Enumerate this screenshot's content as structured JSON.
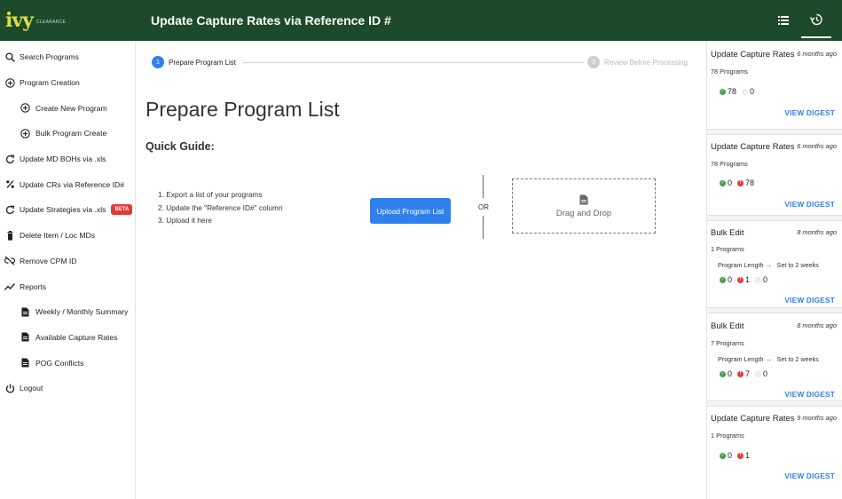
{
  "app": {
    "logo_text": "ivy",
    "logo_sub": "CLEARANCE",
    "title": "Update Capture Rates via Reference ID #"
  },
  "sidebar": {
    "items": [
      {
        "label": "Search Programs",
        "icon": "search-icon"
      },
      {
        "label": "Program Creation",
        "icon": "plus-circle-icon"
      },
      {
        "label": "Create New Program",
        "icon": "plus-circle-icon"
      },
      {
        "label": "Bulk Program Create",
        "icon": "plus-circle-icon"
      },
      {
        "label": "Update MD BOHs via .xls",
        "icon": "refresh-icon"
      },
      {
        "label": "Update CRs via Reference ID#",
        "icon": "percent-icon"
      },
      {
        "label": "Update Strategies via .xls",
        "icon": "refresh-icon",
        "badge": "BETA"
      },
      {
        "label": "Delete Item / Loc MDs",
        "icon": "trash-icon"
      },
      {
        "label": "Remove CPM ID",
        "icon": "link-off-icon"
      },
      {
        "label": "Reports",
        "icon": "trend-icon"
      },
      {
        "label": "Weekly / Monthly Summary",
        "icon": "document-icon"
      },
      {
        "label": "Available Capture Rates",
        "icon": "document-icon"
      },
      {
        "label": "POG Conflicts",
        "icon": "document-icon"
      },
      {
        "label": "Logout",
        "icon": "power-icon"
      }
    ]
  },
  "stepper": {
    "steps": [
      {
        "num": "1",
        "label": "Prepare Program List",
        "active": true
      },
      {
        "num": "2",
        "label": "Review Before Processing",
        "active": false
      }
    ]
  },
  "main": {
    "title": "Prepare Program List",
    "guide_title": "Quick Guide:",
    "guide_steps": [
      "1. Export a list of your programs",
      "2. Update the \"Reference ID#\" column",
      "3. Upload it here"
    ],
    "upload_label": "Upload Program List",
    "or_label": "OR",
    "dropzone_label": "Drag and Drop"
  },
  "history": {
    "view_label": "VIEW DIGEST",
    "cards": [
      {
        "title": "Update Capture Rates",
        "time": "6 months ago",
        "count": "78 Programs",
        "detail": null,
        "stats": [
          {
            "type": "green",
            "value": "78"
          },
          {
            "type": "grey",
            "value": "0"
          }
        ]
      },
      {
        "title": "Update Capture Rates",
        "time": "6 months ago",
        "count": "78 Programs",
        "detail": null,
        "stats": [
          {
            "type": "green",
            "value": "0"
          },
          {
            "type": "red",
            "value": "78"
          }
        ]
      },
      {
        "title": "Bulk Edit",
        "time": "8 months ago",
        "count": "1 Programs",
        "detail": {
          "field": "Program Length",
          "value": "Set to 2 weeks"
        },
        "stats": [
          {
            "type": "green",
            "value": "0"
          },
          {
            "type": "red",
            "value": "1"
          },
          {
            "type": "grey",
            "value": "0"
          }
        ]
      },
      {
        "title": "Bulk Edit",
        "time": "8 months ago",
        "count": "7 Programs",
        "detail": {
          "field": "Program Length",
          "value": "Set to 2 weeks"
        },
        "stats": [
          {
            "type": "green",
            "value": "0"
          },
          {
            "type": "red",
            "value": "7"
          },
          {
            "type": "grey",
            "value": "0"
          }
        ]
      },
      {
        "title": "Update Capture Rates",
        "time": "9 months ago",
        "count": "1 Programs",
        "detail": null,
        "stats": [
          {
            "type": "green",
            "value": "0"
          },
          {
            "type": "red",
            "value": "1"
          }
        ]
      }
    ]
  },
  "colors": {
    "header_bg": "#1d4a2a",
    "accent": "#2f80ed",
    "success": "#43a047",
    "error": "#e53935"
  }
}
